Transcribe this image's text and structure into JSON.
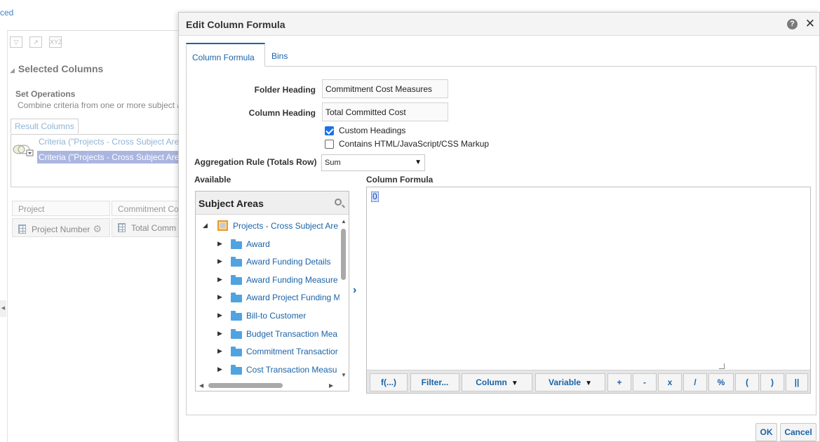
{
  "background": {
    "link_fragment": "ced",
    "section_title": "Selected Columns",
    "set_operations_title": "Set Operations",
    "set_operations_desc": "Combine criteria from one or more subject a",
    "result_columns_tab": "Result Columns",
    "criteria_1": "Criteria (\"Projects - Cross Subject Are",
    "criteria_2": "Criteria (\"Projects - Cross Subject Are",
    "table_headers": [
      "Project",
      "Commitment Co"
    ],
    "table_cells": [
      "Project Number",
      "Total Comm"
    ],
    "toolbar_icon_3": "XYZ"
  },
  "dialog": {
    "title": "Edit Column Formula",
    "help": "?",
    "close": "✕",
    "tabs": [
      {
        "label": "Column Formula",
        "active": true
      },
      {
        "label": "Bins",
        "active": false
      }
    ],
    "folder_heading_label": "Folder Heading",
    "folder_heading_value": "Commitment Cost Measures",
    "column_heading_label": "Column Heading",
    "column_heading_value": "Total Committed Cost",
    "custom_headings_label": "Custom Headings",
    "custom_headings_checked": true,
    "html_markup_label": "Contains HTML/JavaScript/CSS Markup",
    "html_markup_checked": false,
    "aggregation_label": "Aggregation Rule (Totals Row)",
    "aggregation_value": "Sum",
    "available_label": "Available",
    "column_formula_label": "Column Formula",
    "formula_value": "0",
    "subject_areas": {
      "title": "Subject Areas",
      "root": "Projects - Cross Subject Are",
      "items": [
        "Award",
        "Award Funding Details",
        "Award Funding Measure",
        "Award Project Funding M",
        "Bill-to Customer",
        "Budget Transaction Mea",
        "Commitment Transactior",
        "Cost Transaction Measu"
      ]
    },
    "formula_buttons": {
      "func": "f(...)",
      "filter": "Filter...",
      "column": "Column",
      "variable": "Variable",
      "plus": "+",
      "minus": "-",
      "times": "x",
      "divide": "/",
      "percent": "%",
      "lparen": "(",
      "rparen": ")",
      "concat": "||"
    },
    "ok": "OK",
    "cancel": "Cancel"
  }
}
